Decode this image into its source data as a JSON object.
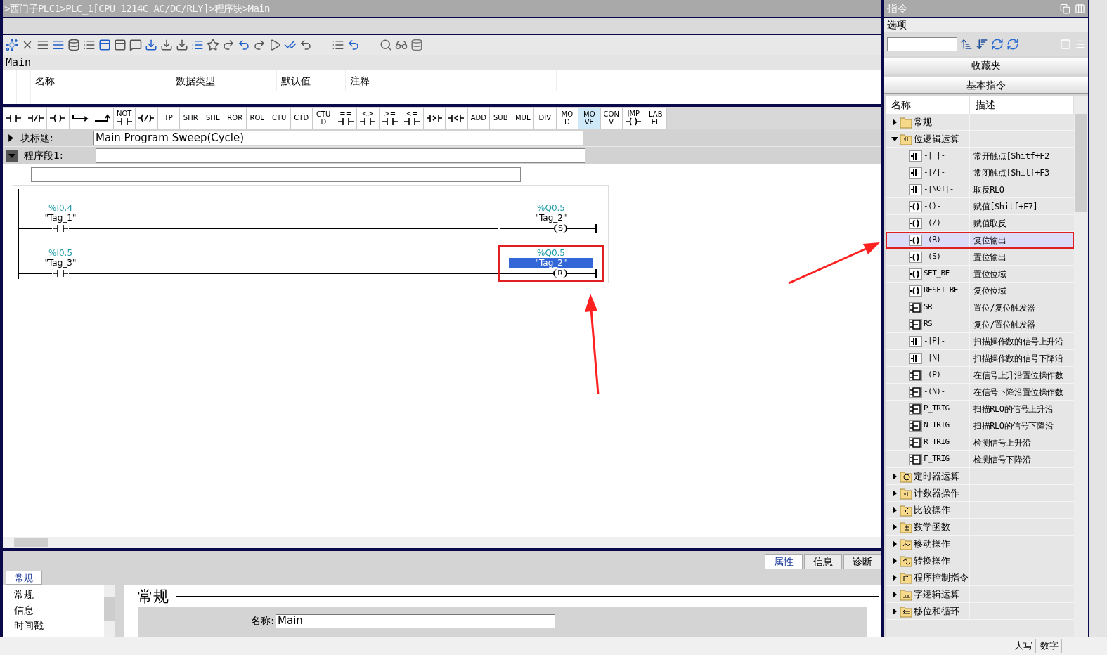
{
  "breadcrumb": ">西门子PLC1>PLC_1[CPU 1214C AC/DC/RLY]>程序块>Main",
  "block_name": "Main",
  "interface_columns": [
    "名称",
    "数据类型",
    "默认值",
    "注释"
  ],
  "palette": [
    {
      "kind": "contact",
      "selected": false
    },
    {
      "kind": "nc-contact",
      "selected": false
    },
    {
      "kind": "coil",
      "selected": false
    },
    {
      "kind": "open-branch",
      "selected": false
    },
    {
      "kind": "close-branch",
      "selected": false
    },
    {
      "kind": "text-contact",
      "lines": [
        "NOT"
      ],
      "selected": false
    },
    {
      "kind": "neg-coil",
      "selected": false
    },
    {
      "kind": "text",
      "lines": [
        "TP"
      ],
      "selected": false
    },
    {
      "kind": "text",
      "lines": [
        "SHR"
      ],
      "selected": false
    },
    {
      "kind": "text",
      "lines": [
        "SHL"
      ],
      "selected": false
    },
    {
      "kind": "text",
      "lines": [
        "ROR"
      ],
      "selected": false
    },
    {
      "kind": "text",
      "lines": [
        "ROL"
      ],
      "selected": false
    },
    {
      "kind": "text",
      "lines": [
        "CTU"
      ],
      "selected": false
    },
    {
      "kind": "text",
      "lines": [
        "CTD"
      ],
      "selected": false
    },
    {
      "kind": "text",
      "lines": [
        "CTU",
        "D"
      ],
      "selected": false
    },
    {
      "kind": "text-contact",
      "lines": [
        "=="
      ],
      "selected": false
    },
    {
      "kind": "text-contact",
      "lines": [
        "<>"
      ],
      "selected": false
    },
    {
      "kind": "text-contact",
      "lines": [
        ">="
      ],
      "selected": false
    },
    {
      "kind": "text-contact",
      "lines": [
        "<="
      ],
      "selected": false
    },
    {
      "kind": "gt-contact",
      "selected": false
    },
    {
      "kind": "lt-contact",
      "selected": false
    },
    {
      "kind": "text",
      "lines": [
        "ADD"
      ],
      "selected": false
    },
    {
      "kind": "text",
      "lines": [
        "SUB"
      ],
      "selected": false
    },
    {
      "kind": "text",
      "lines": [
        "MUL"
      ],
      "selected": false
    },
    {
      "kind": "text",
      "lines": [
        "DIV"
      ],
      "selected": false
    },
    {
      "kind": "text",
      "lines": [
        "MO",
        "D"
      ],
      "selected": false
    },
    {
      "kind": "text",
      "lines": [
        "MO",
        "VE"
      ],
      "selected": true
    },
    {
      "kind": "text",
      "lines": [
        "CON",
        "V"
      ],
      "selected": false
    },
    {
      "kind": "text-coil",
      "lines": [
        "JMP"
      ],
      "selected": false
    },
    {
      "kind": "text",
      "lines": [
        "LAB",
        "EL"
      ],
      "selected": false
    }
  ],
  "block_title": {
    "label": "块标题:",
    "value": "Main Program Sweep(Cycle)",
    "expanded": false
  },
  "network": {
    "label": "程序段1:",
    "expanded": true
  },
  "rungs": [
    {
      "contact_address": "%I0.4",
      "contact_tag": "\"Tag_1\"",
      "coil_address": "%Q0.5",
      "coil_tag": "\"Tag_2\"",
      "coil_type": "S",
      "tag_selected": false,
      "highlighted": false
    },
    {
      "contact_address": "%I0.5",
      "contact_tag": "\"Tag_3\"",
      "coil_address": "%Q0.5",
      "coil_tag": "\"Tag_2\"",
      "coil_type": "R",
      "tag_selected": true,
      "highlighted": true
    }
  ],
  "inspector": {
    "tabs": [
      {
        "label": "属性",
        "selected": true
      },
      {
        "label": "信息",
        "selected": false
      },
      {
        "label": "诊断",
        "selected": false
      }
    ],
    "section_tab": "常规",
    "nav": [
      "常规",
      "信息",
      "时间戳"
    ],
    "heading": "常规",
    "fields": [
      {
        "label": "名称:",
        "value": "Main"
      }
    ]
  },
  "instructions": {
    "title": "指令",
    "options": "选项",
    "favorites": "收藏夹",
    "basic": "基本指令",
    "columns": [
      "名称",
      "描述"
    ],
    "tree": [
      {
        "name": "常规",
        "kind": "plain",
        "expanded": false
      },
      {
        "name": "位逻辑运算",
        "kind": "contact",
        "expanded": true,
        "children": [
          {
            "name": "-| |-",
            "kind": "contact",
            "description": "常开触点[Shitf+F2",
            "selected": false,
            "highlighted": false
          },
          {
            "name": "-|/|-",
            "kind": "contact",
            "description": "常闭触点[Shitf+F3",
            "selected": false,
            "highlighted": false
          },
          {
            "name": "-|NOT|-",
            "kind": "contact",
            "description": "取反RLO",
            "selected": false,
            "highlighted": false
          },
          {
            "name": "-()-",
            "kind": "coil",
            "description": "赋值[Shitf+F7]",
            "selected": false,
            "highlighted": false
          },
          {
            "name": "-(/)-",
            "kind": "coil",
            "description": "赋值取反",
            "selected": false,
            "highlighted": false
          },
          {
            "name": "-(R)",
            "kind": "coil",
            "description": "复位输出",
            "selected": true,
            "highlighted": true
          },
          {
            "name": "-(S)",
            "kind": "coil",
            "description": "置位输出",
            "selected": false,
            "highlighted": false
          },
          {
            "name": "SET_BF",
            "kind": "coil",
            "description": "置位位域",
            "selected": false,
            "highlighted": false
          },
          {
            "name": "RESET_BF",
            "kind": "coil",
            "description": "复位位域",
            "selected": false,
            "highlighted": false
          },
          {
            "name": "SR",
            "kind": "block",
            "description": "置位/复位触发器",
            "selected": false,
            "highlighted": false
          },
          {
            "name": "RS",
            "kind": "block",
            "description": "复位/置位触发器",
            "selected": false,
            "highlighted": false
          },
          {
            "name": "-|P|-",
            "kind": "contact",
            "description": "扫描操作数的信号上升沿",
            "selected": false,
            "highlighted": false
          },
          {
            "name": "-|N|-",
            "kind": "contact",
            "description": "扫描操作数的信号下降沿",
            "selected": false,
            "highlighted": false
          },
          {
            "name": "-(P)-",
            "kind": "block",
            "description": "在信号上升沿置位操作数",
            "selected": false,
            "highlighted": false
          },
          {
            "name": "-(N)-",
            "kind": "block",
            "description": "在信号下降沿置位操作数",
            "selected": false,
            "highlighted": false
          },
          {
            "name": "P_TRIG",
            "kind": "block",
            "description": "扫描RLO的信号上升沿",
            "selected": false,
            "highlighted": false
          },
          {
            "name": "N_TRIG",
            "kind": "block",
            "description": "扫描RLO的信号下降沿",
            "selected": false,
            "highlighted": false
          },
          {
            "name": "R_TRIG",
            "kind": "block",
            "description": "检测信号上升沿",
            "selected": false,
            "highlighted": false
          },
          {
            "name": "F_TRIG",
            "kind": "block",
            "description": "检测信号下降沿",
            "selected": false,
            "highlighted": false
          }
        ]
      },
      {
        "name": "定时器运算",
        "kind": "timer",
        "expanded": false
      },
      {
        "name": "计数器操作",
        "kind": "counter",
        "expanded": false
      },
      {
        "name": "比较操作",
        "kind": "compare",
        "expanded": false
      },
      {
        "name": "数学函数",
        "kind": "math",
        "expanded": false
      },
      {
        "name": "移动操作",
        "kind": "move",
        "expanded": false
      },
      {
        "name": "转换操作",
        "kind": "convert",
        "expanded": false
      },
      {
        "name": "程序控制指令",
        "kind": "program",
        "expanded": false
      },
      {
        "name": "字逻辑运算",
        "kind": "word",
        "expanded": false
      },
      {
        "name": "移位和循环",
        "kind": "shift",
        "expanded": false
      }
    ]
  },
  "status_bar": [
    "大写",
    "数字"
  ]
}
